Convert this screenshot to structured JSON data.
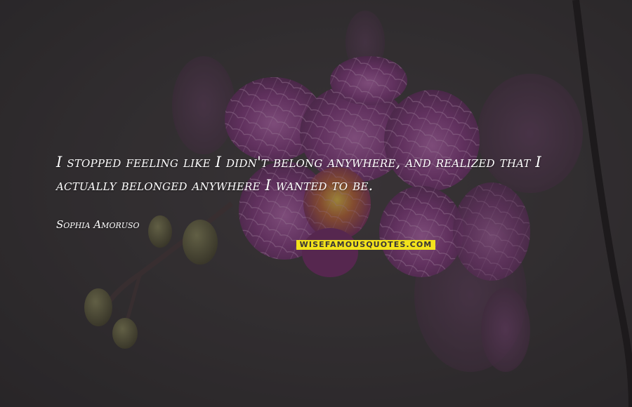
{
  "quote": {
    "text": "I stopped feeling like I didn't belong anywhere, and realized that I actually belonged anywhere I wanted to be.",
    "author": "Sophia Amoruso"
  },
  "watermark": {
    "text": "WISEFAMOUSQUOTES.COM",
    "background_color": "#f2e21c"
  },
  "background": {
    "subject": "purple orchid flowers",
    "base_color": "#3e3a3c",
    "petal_color": "#7a3a78",
    "vein_color": "#c98fc4"
  }
}
